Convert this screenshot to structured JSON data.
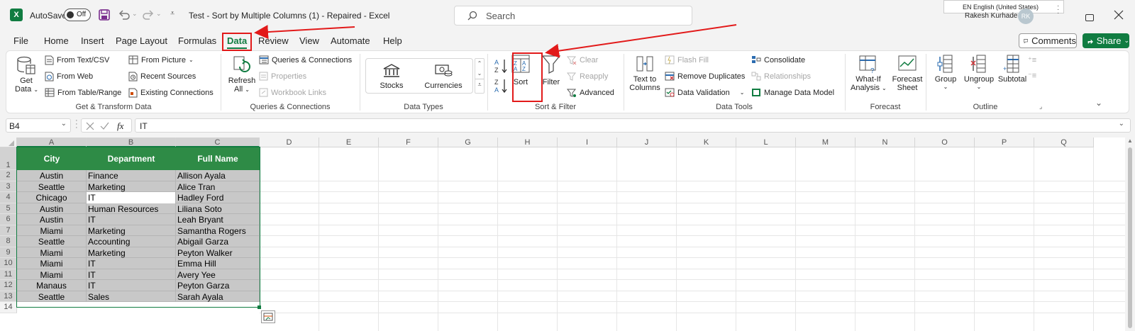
{
  "title": {
    "autosave_label": "AutoSave",
    "autosave_state": "Off",
    "doc_title": "Test - Sort by Multiple Columns (1)  -  Repaired  -  Excel",
    "search_placeholder": "Search",
    "lang_tooltip": "EN English (United States)",
    "user_name": "Rakesh Kurhade",
    "user_initials": "RK"
  },
  "tabs": [
    "File",
    "Home",
    "Insert",
    "Page Layout",
    "Formulas",
    "Data",
    "Review",
    "View",
    "Automate",
    "Help"
  ],
  "comments_label": "Comments",
  "share_label": "Share",
  "ribbon": {
    "get_data": {
      "line1": "Get",
      "line2": "Data"
    },
    "from_text_csv": "From Text/CSV",
    "from_web": "From Web",
    "from_table_range": "From Table/Range",
    "from_picture": "From Picture",
    "recent_sources": "Recent Sources",
    "existing_connections": "Existing Connections",
    "group_get_transform": "Get & Transform Data",
    "refresh_all": {
      "line1": "Refresh",
      "line2": "All"
    },
    "queries_connections": "Queries & Connections",
    "properties": "Properties",
    "workbook_links": "Workbook Links",
    "group_queries": "Queries & Connections",
    "stocks": "Stocks",
    "currencies": "Currencies",
    "group_data_types": "Data Types",
    "sort": "Sort",
    "filter": "Filter",
    "clear": "Clear",
    "reapply": "Reapply",
    "advanced": "Advanced",
    "group_sort_filter": "Sort & Filter",
    "text_to_columns": {
      "line1": "Text to",
      "line2": "Columns"
    },
    "flash_fill": "Flash Fill",
    "remove_duplicates": "Remove Duplicates",
    "data_validation": "Data Validation",
    "consolidate": "Consolidate",
    "relationships": "Relationships",
    "manage_data_model": "Manage Data Model",
    "group_data_tools": "Data Tools",
    "what_if": {
      "line1": "What-If",
      "line2": "Analysis"
    },
    "forecast_sheet": {
      "line1": "Forecast",
      "line2": "Sheet"
    },
    "group_forecast": "Forecast",
    "group": "Group",
    "ungroup": "Ungroup",
    "subtotal": "Subtotal",
    "group_outline": "Outline"
  },
  "formula_bar": {
    "name_box": "B4",
    "fx": "fx",
    "value": "IT"
  },
  "columns": [
    "A",
    "B",
    "C",
    "D",
    "E",
    "F",
    "G",
    "H",
    "I",
    "J",
    "K",
    "L",
    "M",
    "N",
    "O",
    "P",
    "Q"
  ],
  "headers": [
    "City",
    "Department",
    "Full Name"
  ],
  "rows": [
    [
      "Austin",
      "Finance",
      "Allison Ayala"
    ],
    [
      "Seattle",
      "Marketing",
      "Alice Tran"
    ],
    [
      "Chicago",
      "IT",
      "Hadley Ford"
    ],
    [
      "Austin",
      "Human Resources",
      "Liliana Soto"
    ],
    [
      "Austin",
      "IT",
      "Leah Bryant"
    ],
    [
      "Miami",
      "Marketing",
      "Samantha Rogers"
    ],
    [
      "Seattle",
      "Accounting",
      "Abigail Garza"
    ],
    [
      "Miami",
      "Marketing",
      "Peyton Walker"
    ],
    [
      "Miami",
      "IT",
      "Emma Hill"
    ],
    [
      "Miami",
      "IT",
      "Avery Yee"
    ],
    [
      "Manaus",
      "IT",
      "Peyton Garza"
    ],
    [
      "Seattle",
      "Sales",
      "Sarah Ayala"
    ]
  ],
  "row_numbers": [
    "1",
    "2",
    "3",
    "4",
    "5",
    "6",
    "7",
    "8",
    "9",
    "10",
    "11",
    "12",
    "13",
    "14"
  ],
  "colors": {
    "excel_green": "#217346",
    "header_fill": "#2e8b46",
    "selection_fill": "#c8c8c8",
    "annotation_red": "#e21a1a"
  }
}
